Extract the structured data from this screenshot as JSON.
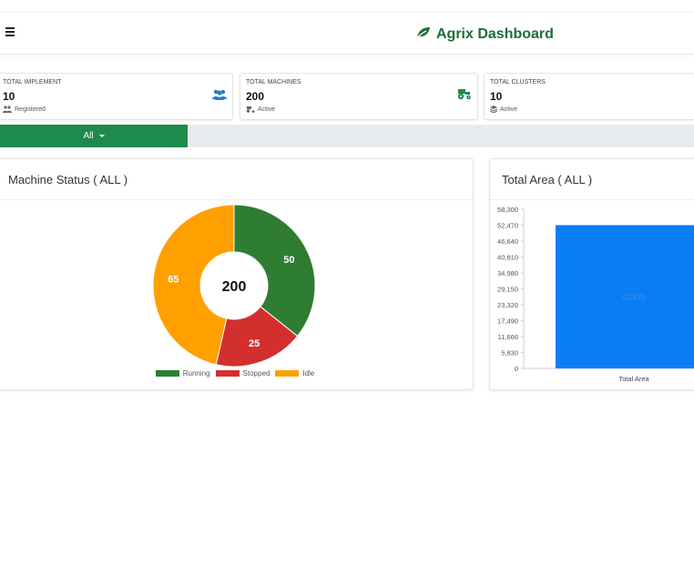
{
  "navbar": {
    "brand": "Agrix Dashboard",
    "brand_color": "#1f6d33",
    "menu_icon": "hamburger-icon",
    "brand_icon": "leaf-icon"
  },
  "cards": [
    {
      "title": "TOTAL IMPLEMENT",
      "value": "10",
      "foot": "Registered",
      "icon": "users-icon",
      "foot_icon": "users-icon",
      "icon_color": "#2a7bd3"
    },
    {
      "title": "TOTAL MACHINES",
      "value": "200",
      "foot": "Active",
      "icon": "tractor-icon",
      "foot_icon": "tractor-icon",
      "icon_color": "#1e8a4b"
    },
    {
      "title": "TOTAL CLUSTERS",
      "value": "10",
      "foot": "Active",
      "icon": "layers-icon",
      "foot_icon": "layers-icon"
    }
  ],
  "filter": {
    "selected": "All",
    "active_color": "#1e8a4b"
  },
  "machine_status": {
    "title": "Machine Status ( ALL )",
    "center_value": "200"
  },
  "total_area": {
    "title": "Total Area ( ALL )",
    "bar_label": "52,470"
  },
  "chart_data": [
    {
      "type": "pie",
      "donut": true,
      "title": "Machine Status ( ALL )",
      "center_label": "200",
      "categories": [
        "Running",
        "Stopped",
        "Idle"
      ],
      "values": [
        50,
        25,
        65
      ],
      "colors": [
        "#2e7d32",
        "#d32f2f",
        "#ffa000"
      ],
      "legend": "bottom"
    },
    {
      "type": "bar",
      "title": "Total Area ( ALL )",
      "categories": [
        "Total Area"
      ],
      "values": [
        52470
      ],
      "bar_color": "#0a7df5",
      "yticks": [
        "58,300",
        "52,470",
        "46,640",
        "40,810",
        "34,980",
        "29,150",
        "23,320",
        "17,490",
        "11,660",
        "5,830",
        "0"
      ],
      "ylim": [
        0,
        58300
      ],
      "grid": false
    }
  ]
}
